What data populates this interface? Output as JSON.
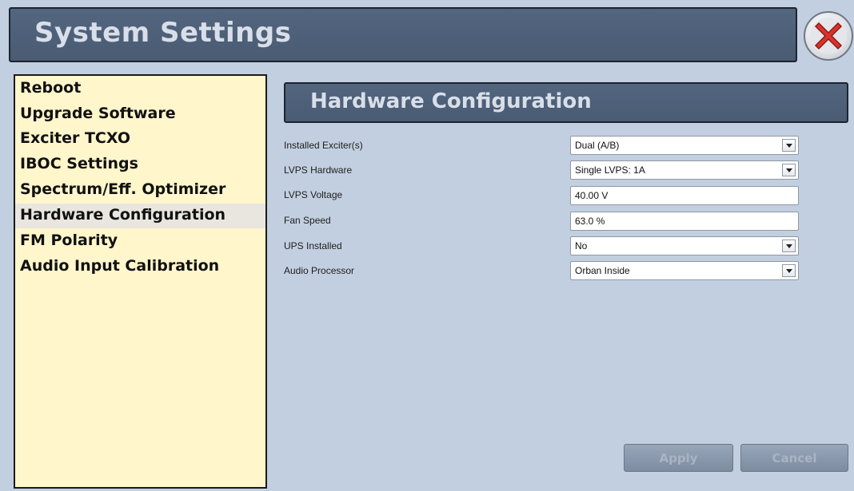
{
  "header": {
    "title": "System Settings",
    "close_icon": "close-x-icon"
  },
  "sidebar": {
    "items": [
      {
        "label": "Reboot",
        "active": false
      },
      {
        "label": "Upgrade Software",
        "active": false
      },
      {
        "label": "Exciter TCXO",
        "active": false
      },
      {
        "label": "IBOC Settings",
        "active": false
      },
      {
        "label": "Spectrum/Eff. Optimizer",
        "active": false
      },
      {
        "label": "Hardware Configuration",
        "active": true
      },
      {
        "label": "FM Polarity",
        "active": false
      },
      {
        "label": "Audio Input Calibration",
        "active": false
      }
    ]
  },
  "main": {
    "title": "Hardware Configuration",
    "fields": [
      {
        "label": "Installed Exciter(s)",
        "type": "select",
        "value": "Dual (A/B)"
      },
      {
        "label": "LVPS Hardware",
        "type": "select",
        "value": "Single LVPS: 1A"
      },
      {
        "label": "LVPS Voltage",
        "type": "text",
        "value": "40.00 V"
      },
      {
        "label": "Fan Speed",
        "type": "text",
        "value": "63.0 %"
      },
      {
        "label": "UPS Installed",
        "type": "select",
        "value": "No"
      },
      {
        "label": "Audio Processor",
        "type": "select",
        "value": "Orban Inside"
      }
    ],
    "apply_label": "Apply",
    "cancel_label": "Cancel"
  },
  "colors": {
    "background": "#c2cfe0",
    "header_bg": "#4e6079",
    "sidebar_bg": "#fff6cc",
    "close_red": "#d8332c"
  }
}
